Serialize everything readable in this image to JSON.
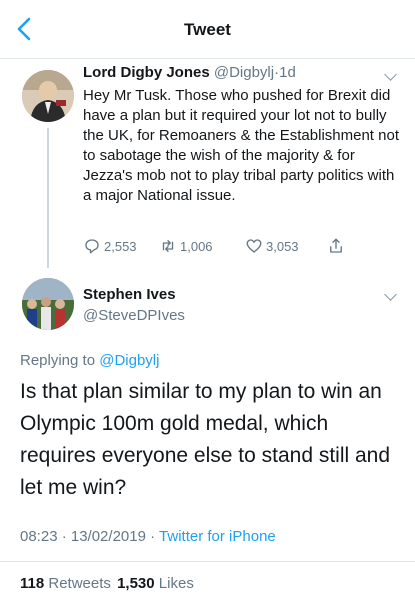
{
  "nav": {
    "title": "Tweet"
  },
  "tweet1": {
    "author_name": "Lord Digby Jones",
    "handle": "@Digbylj",
    "dot": "·",
    "time": "1d",
    "text": "Hey Mr Tusk. Those who pushed for Brexit did have a plan but it required your lot not to bully the UK, for Remoaners & the Establishment not to sabotage the wish of the majority & for Jezza's mob not to play tribal party politics with a major National issue.",
    "replies": "2,553",
    "retweets": "1,006",
    "likes": "3,053"
  },
  "tweet2": {
    "author_name": "Stephen Ives",
    "handle": "@SteveDPIves",
    "replying_prefix": "Replying to",
    "replying_to": "@Digbylj",
    "text": "Is that plan similar to my plan to win an Olympic 100m gold medal, which requires everyone else to stand still and let me win?",
    "timestamp": "08:23 · 13/02/2019",
    "source_sep": "·",
    "source": "Twitter for iPhone",
    "retweet_count": "118",
    "retweet_label": "Retweets",
    "like_count": "1,530",
    "like_label": "Likes"
  },
  "colors": {
    "accent": "#1da1f2",
    "muted": "#657786",
    "text": "#14171a",
    "divider": "#e1e8ed"
  }
}
